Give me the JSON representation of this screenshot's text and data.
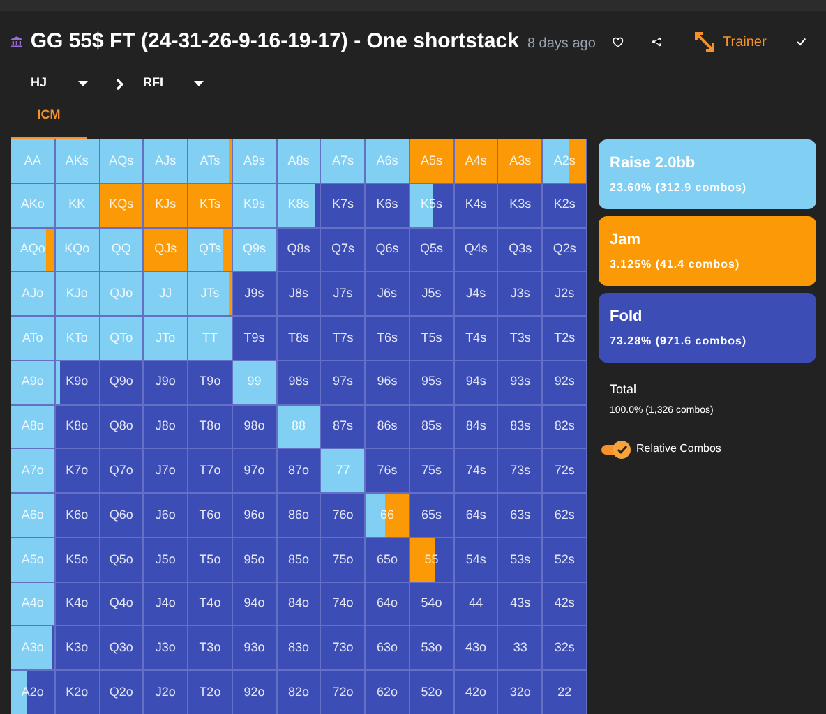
{
  "header": {
    "title": "GG 55$ FT (24-31-26-9-16-19-17) - One shortstack",
    "age": "8 days ago",
    "trainer": "Trainer"
  },
  "breadcrumb": [
    {
      "label": "HJ"
    },
    {
      "label": "RFI"
    }
  ],
  "tabs": [
    {
      "label": "ICM",
      "selected": true
    }
  ],
  "legend": [
    {
      "kind": "raise",
      "label": "Raise 2.0bb",
      "stats": "23.60% (312.9 combos)",
      "color": "#82cff4"
    },
    {
      "kind": "jam",
      "label": "Jam",
      "stats": "3.125% (41.4 combos)",
      "color": "#fb9a06"
    },
    {
      "kind": "fold",
      "label": "Fold",
      "stats": "73.28% (971.6 combos)",
      "color": "#3c4db5"
    }
  ],
  "total": {
    "label": "Total",
    "stats": "100.0% (1,326 combos)"
  },
  "relative_combos": {
    "label": "Relative Combos",
    "on": true
  },
  "grid": {
    "rows": [
      {
        "cells": [
          {
            "hand": "AA",
            "kind": "raise"
          },
          {
            "hand": "AKs",
            "kind": "raise"
          },
          {
            "hand": "AQs",
            "kind": "raise"
          },
          {
            "hand": "AJs",
            "kind": "raise"
          },
          {
            "hand": "ATs",
            "kind": "edgejam"
          },
          {
            "hand": "A9s",
            "kind": "raise"
          },
          {
            "hand": "A8s",
            "kind": "raise"
          },
          {
            "hand": "A7s",
            "kind": "raise"
          },
          {
            "hand": "A6s",
            "kind": "raise"
          },
          {
            "hand": "A5s",
            "kind": "jam"
          },
          {
            "hand": "A4s",
            "kind": "jam"
          },
          {
            "hand": "A3s",
            "kind": "jam"
          },
          {
            "hand": "A2s",
            "kind": "bigjam"
          }
        ]
      },
      {
        "cells": [
          {
            "hand": "AKo",
            "kind": "raise"
          },
          {
            "hand": "KK",
            "kind": "raise"
          },
          {
            "hand": "KQs",
            "kind": "jam"
          },
          {
            "hand": "KJs",
            "kind": "jam"
          },
          {
            "hand": "KTs",
            "kind": "jam"
          },
          {
            "hand": "K9s",
            "kind": "raise"
          },
          {
            "hand": "K8s",
            "kind": "edgefold"
          },
          {
            "hand": "K7s",
            "kind": "fold"
          },
          {
            "hand": "K6s",
            "kind": "fold"
          },
          {
            "hand": "K5s",
            "kind": "halffold"
          },
          {
            "hand": "K4s",
            "kind": "fold"
          },
          {
            "hand": "K3s",
            "kind": "fold"
          },
          {
            "hand": "K2s",
            "kind": "fold"
          }
        ]
      },
      {
        "cells": [
          {
            "hand": "AQo",
            "kind": "tailjam"
          },
          {
            "hand": "KQo",
            "kind": "raise"
          },
          {
            "hand": "QQ",
            "kind": "raise"
          },
          {
            "hand": "QJs",
            "kind": "jam"
          },
          {
            "hand": "QTs",
            "kind": "tailjam"
          },
          {
            "hand": "Q9s",
            "kind": "raise"
          },
          {
            "hand": "Q8s",
            "kind": "fold"
          },
          {
            "hand": "Q7s",
            "kind": "fold"
          },
          {
            "hand": "Q6s",
            "kind": "fold"
          },
          {
            "hand": "Q5s",
            "kind": "fold"
          },
          {
            "hand": "Q4s",
            "kind": "fold"
          },
          {
            "hand": "Q3s",
            "kind": "fold"
          },
          {
            "hand": "Q2s",
            "kind": "fold"
          }
        ]
      },
      {
        "cells": [
          {
            "hand": "AJo",
            "kind": "raise"
          },
          {
            "hand": "KJo",
            "kind": "raise"
          },
          {
            "hand": "QJo",
            "kind": "raise"
          },
          {
            "hand": "JJ",
            "kind": "raise"
          },
          {
            "hand": "JTs",
            "kind": "edgejam"
          },
          {
            "hand": "J9s",
            "kind": "fold"
          },
          {
            "hand": "J8s",
            "kind": "fold"
          },
          {
            "hand": "J7s",
            "kind": "fold"
          },
          {
            "hand": "J6s",
            "kind": "fold"
          },
          {
            "hand": "J5s",
            "kind": "fold"
          },
          {
            "hand": "J4s",
            "kind": "fold"
          },
          {
            "hand": "J3s",
            "kind": "fold"
          },
          {
            "hand": "J2s",
            "kind": "fold"
          }
        ]
      },
      {
        "cells": [
          {
            "hand": "ATo",
            "kind": "raise"
          },
          {
            "hand": "KTo",
            "kind": "raise"
          },
          {
            "hand": "QTo",
            "kind": "raise"
          },
          {
            "hand": "JTo",
            "kind": "raise"
          },
          {
            "hand": "TT",
            "kind": "raise"
          },
          {
            "hand": "T9s",
            "kind": "fold"
          },
          {
            "hand": "T8s",
            "kind": "fold"
          },
          {
            "hand": "T7s",
            "kind": "fold"
          },
          {
            "hand": "T6s",
            "kind": "fold"
          },
          {
            "hand": "T5s",
            "kind": "fold"
          },
          {
            "hand": "T4s",
            "kind": "fold"
          },
          {
            "hand": "T3s",
            "kind": "fold"
          },
          {
            "hand": "T2s",
            "kind": "fold"
          }
        ]
      },
      {
        "cells": [
          {
            "hand": "A9o",
            "kind": "raise"
          },
          {
            "hand": "K9o",
            "kind": "tipraise"
          },
          {
            "hand": "Q9o",
            "kind": "fold"
          },
          {
            "hand": "J9o",
            "kind": "fold"
          },
          {
            "hand": "T9o",
            "kind": "fold"
          },
          {
            "hand": "99",
            "kind": "raise"
          },
          {
            "hand": "98s",
            "kind": "fold"
          },
          {
            "hand": "97s",
            "kind": "fold"
          },
          {
            "hand": "96s",
            "kind": "fold"
          },
          {
            "hand": "95s",
            "kind": "fold"
          },
          {
            "hand": "94s",
            "kind": "fold"
          },
          {
            "hand": "93s",
            "kind": "fold"
          },
          {
            "hand": "92s",
            "kind": "fold"
          }
        ]
      },
      {
        "cells": [
          {
            "hand": "A8o",
            "kind": "raise"
          },
          {
            "hand": "K8o",
            "kind": "fold"
          },
          {
            "hand": "Q8o",
            "kind": "fold"
          },
          {
            "hand": "J8o",
            "kind": "fold"
          },
          {
            "hand": "T8o",
            "kind": "fold"
          },
          {
            "hand": "98o",
            "kind": "fold"
          },
          {
            "hand": "88",
            "kind": "raise"
          },
          {
            "hand": "87s",
            "kind": "fold"
          },
          {
            "hand": "86s",
            "kind": "fold"
          },
          {
            "hand": "85s",
            "kind": "fold"
          },
          {
            "hand": "84s",
            "kind": "fold"
          },
          {
            "hand": "83s",
            "kind": "fold"
          },
          {
            "hand": "82s",
            "kind": "fold"
          }
        ]
      },
      {
        "cells": [
          {
            "hand": "A7o",
            "kind": "raise"
          },
          {
            "hand": "K7o",
            "kind": "fold"
          },
          {
            "hand": "Q7o",
            "kind": "fold"
          },
          {
            "hand": "J7o",
            "kind": "fold"
          },
          {
            "hand": "T7o",
            "kind": "fold"
          },
          {
            "hand": "97o",
            "kind": "fold"
          },
          {
            "hand": "87o",
            "kind": "fold"
          },
          {
            "hand": "77",
            "kind": "raise"
          },
          {
            "hand": "76s",
            "kind": "fold"
          },
          {
            "hand": "75s",
            "kind": "fold"
          },
          {
            "hand": "74s",
            "kind": "fold"
          },
          {
            "hand": "73s",
            "kind": "fold"
          },
          {
            "hand": "72s",
            "kind": "fold"
          }
        ]
      },
      {
        "cells": [
          {
            "hand": "A6o",
            "kind": "raise"
          },
          {
            "hand": "K6o",
            "kind": "fold"
          },
          {
            "hand": "Q6o",
            "kind": "fold"
          },
          {
            "hand": "J6o",
            "kind": "fold"
          },
          {
            "hand": "T6o",
            "kind": "fold"
          },
          {
            "hand": "96o",
            "kind": "fold"
          },
          {
            "hand": "86o",
            "kind": "fold"
          },
          {
            "hand": "76o",
            "kind": "fold"
          },
          {
            "hand": "66",
            "kind": "halfjam"
          },
          {
            "hand": "65s",
            "kind": "fold"
          },
          {
            "hand": "64s",
            "kind": "fold"
          },
          {
            "hand": "63s",
            "kind": "fold"
          },
          {
            "hand": "62s",
            "kind": "fold"
          }
        ]
      },
      {
        "cells": [
          {
            "hand": "A5o",
            "kind": "raise"
          },
          {
            "hand": "K5o",
            "kind": "fold"
          },
          {
            "hand": "Q5o",
            "kind": "fold"
          },
          {
            "hand": "J5o",
            "kind": "fold"
          },
          {
            "hand": "T5o",
            "kind": "fold"
          },
          {
            "hand": "95o",
            "kind": "fold"
          },
          {
            "hand": "85o",
            "kind": "fold"
          },
          {
            "hand": "75o",
            "kind": "fold"
          },
          {
            "hand": "65o",
            "kind": "fold"
          },
          {
            "hand": "55",
            "kind": "jamfold"
          },
          {
            "hand": "54s",
            "kind": "fold"
          },
          {
            "hand": "53s",
            "kind": "fold"
          },
          {
            "hand": "52s",
            "kind": "fold"
          }
        ]
      },
      {
        "cells": [
          {
            "hand": "A4o",
            "kind": "raise"
          },
          {
            "hand": "K4o",
            "kind": "fold"
          },
          {
            "hand": "Q4o",
            "kind": "fold"
          },
          {
            "hand": "J4o",
            "kind": "fold"
          },
          {
            "hand": "T4o",
            "kind": "fold"
          },
          {
            "hand": "94o",
            "kind": "fold"
          },
          {
            "hand": "84o",
            "kind": "fold"
          },
          {
            "hand": "74o",
            "kind": "fold"
          },
          {
            "hand": "64o",
            "kind": "fold"
          },
          {
            "hand": "54o",
            "kind": "fold"
          },
          {
            "hand": "44",
            "kind": "fold"
          },
          {
            "hand": "43s",
            "kind": "fold"
          },
          {
            "hand": "42s",
            "kind": "fold"
          }
        ]
      },
      {
        "cells": [
          {
            "hand": "A3o",
            "kind": "rimfold"
          },
          {
            "hand": "K3o",
            "kind": "fold"
          },
          {
            "hand": "Q3o",
            "kind": "fold"
          },
          {
            "hand": "J3o",
            "kind": "fold"
          },
          {
            "hand": "T3o",
            "kind": "fold"
          },
          {
            "hand": "93o",
            "kind": "fold"
          },
          {
            "hand": "83o",
            "kind": "fold"
          },
          {
            "hand": "73o",
            "kind": "fold"
          },
          {
            "hand": "63o",
            "kind": "fold"
          },
          {
            "hand": "53o",
            "kind": "fold"
          },
          {
            "hand": "43o",
            "kind": "fold"
          },
          {
            "hand": "33",
            "kind": "fold"
          },
          {
            "hand": "32s",
            "kind": "fold"
          }
        ]
      },
      {
        "cells": [
          {
            "hand": "A2o",
            "kind": "thirdraise"
          },
          {
            "hand": "K2o",
            "kind": "fold"
          },
          {
            "hand": "Q2o",
            "kind": "fold"
          },
          {
            "hand": "J2o",
            "kind": "fold"
          },
          {
            "hand": "T2o",
            "kind": "fold"
          },
          {
            "hand": "92o",
            "kind": "fold"
          },
          {
            "hand": "82o",
            "kind": "fold"
          },
          {
            "hand": "72o",
            "kind": "fold"
          },
          {
            "hand": "62o",
            "kind": "fold"
          },
          {
            "hand": "52o",
            "kind": "fold"
          },
          {
            "hand": "42o",
            "kind": "fold"
          },
          {
            "hand": "32o",
            "kind": "fold"
          },
          {
            "hand": "22",
            "kind": "fold"
          }
        ]
      }
    ]
  }
}
